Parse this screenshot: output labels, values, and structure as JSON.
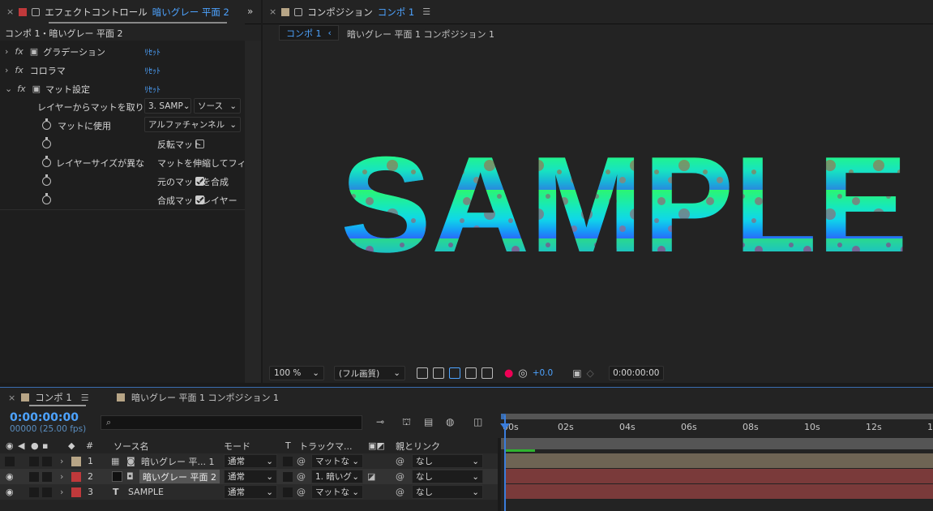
{
  "effect_panel": {
    "tab_prefix": "エフェクトコントロール",
    "tab_highlight": "暗いグレー 平面 2",
    "breadcrumb": "コンポ 1・暗いグレー 平面 2",
    "effects": [
      {
        "name": "グラデーション",
        "reset": "ﾘｾｯﾄ"
      },
      {
        "name": "コロラマ",
        "reset": "ﾘｾｯﾄ"
      },
      {
        "name": "マット設定",
        "reset": "ﾘｾｯﾄ"
      }
    ],
    "matte": {
      "take_label": "レイヤーからマットを取り込",
      "take_layer": "3. SAMP",
      "take_source": "ソース",
      "use_label": "マットに使用",
      "use_value": "アルファチャンネル",
      "invert_label": "反転マット",
      "size_label": "レイヤーサイズが異な",
      "stretch_label": "マットを伸縮してフィッ",
      "composite_label": "元のマットを合成",
      "premult_label": "合成マットレイヤー"
    }
  },
  "comp_panel": {
    "tab_prefix": "コンポジション",
    "tab_highlight": "コンポ 1",
    "nav_current": "コンポ 1",
    "nav_other": "暗いグレー 平面 1 コンポジション 1",
    "canvas_text": "SAMPLE",
    "zoom": "100 %",
    "quality": "(フル画質)",
    "exposure": "+0.0",
    "timecode": "0:00:00:00"
  },
  "timeline": {
    "tab1": "コンポ 1",
    "tab2": "暗いグレー 平面 1 コンポジション 1",
    "current_time": "0:00:00:00",
    "frame_info": "00000 (25.00 fps)",
    "search_placeholder": "",
    "col_num": "#",
    "col_source": "ソース名",
    "col_mode": "モード",
    "col_t": "T",
    "col_track": "トラックマ...",
    "col_parent": "親とリンク",
    "ruler": [
      "00s",
      "02s",
      "04s",
      "06s",
      "08s",
      "10s",
      "12s",
      "1"
    ],
    "layers": [
      {
        "num": "1",
        "name": "暗いグレー 平... 1",
        "mode": "通常",
        "track": "マットな",
        "parent": "なし",
        "color": "#b7a586",
        "bar": "#6e6454"
      },
      {
        "num": "2",
        "name": "暗いグレー 平面 2",
        "mode": "通常",
        "track": "1. 暗いグ",
        "parent": "なし",
        "color": "#c0393b",
        "bar": "#7a3a3a"
      },
      {
        "num": "3",
        "name": "SAMPLE",
        "mode": "通常",
        "track": "マットな",
        "parent": "なし",
        "color": "#c0393b",
        "bar": "#7a3a3a"
      }
    ]
  },
  "colors": {
    "accent": "#4da3ff",
    "panel_bg": "#232323"
  }
}
